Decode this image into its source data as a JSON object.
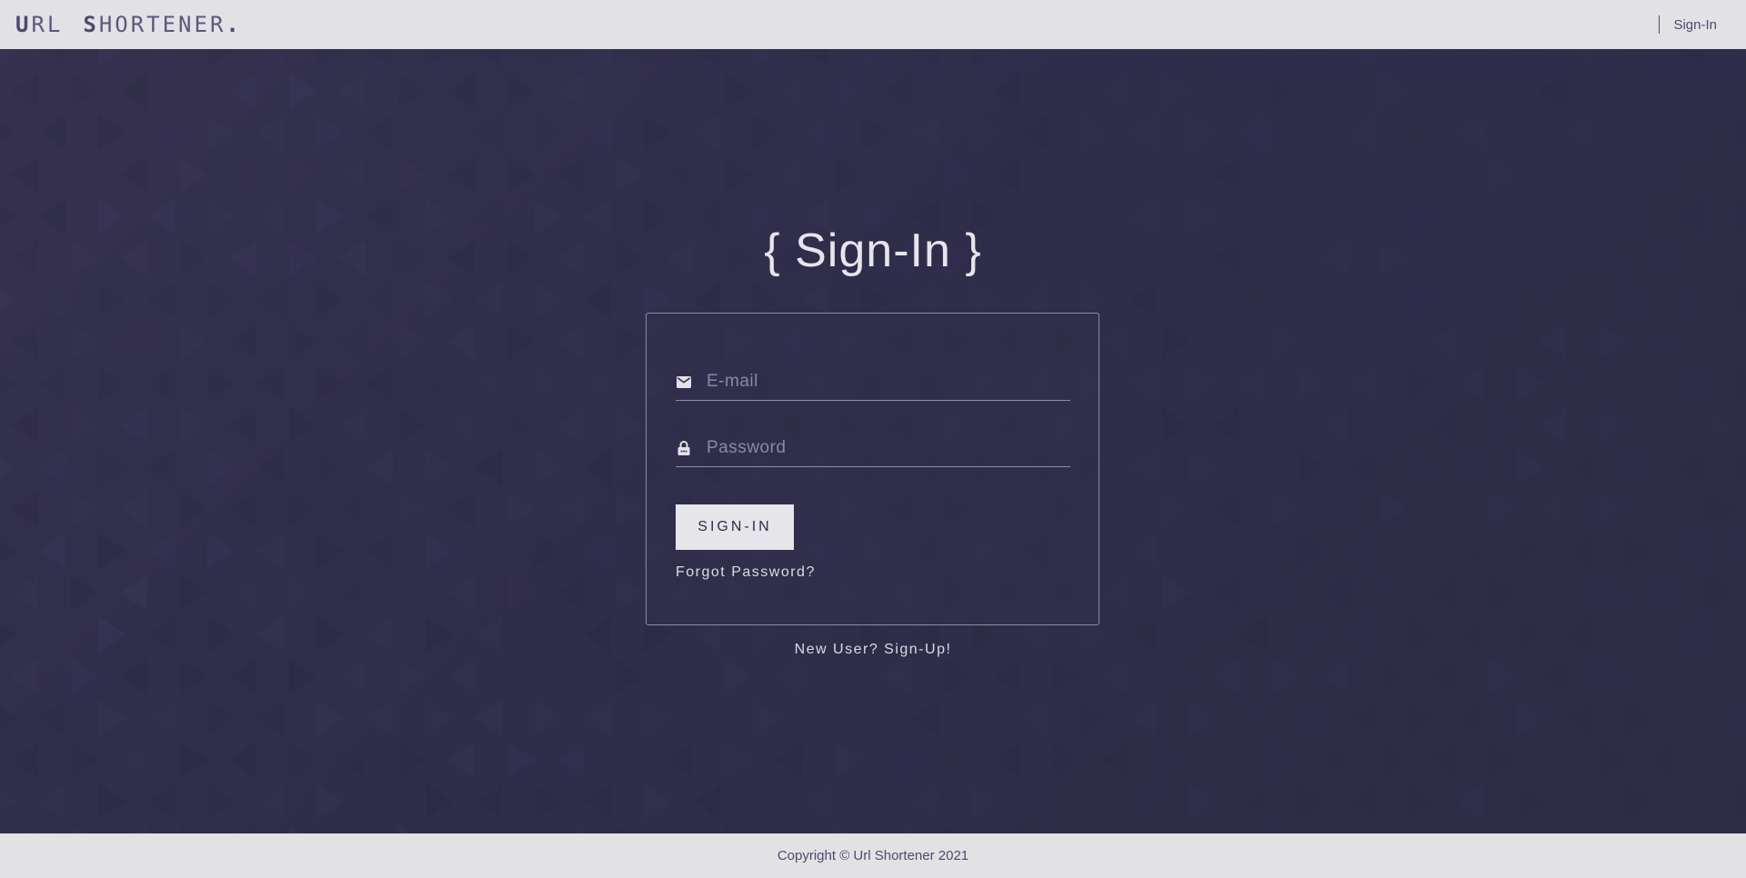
{
  "header": {
    "logo": {
      "part1_lead": "U",
      "part1_rest": "RL",
      "part2_lead": "S",
      "part2_rest": "HORTENER",
      "dot": "."
    },
    "nav": {
      "signin_label": "Sign-In"
    }
  },
  "main": {
    "title": "{ Sign-In }",
    "form": {
      "email": {
        "icon": "envelope-icon",
        "placeholder": "E-mail",
        "value": ""
      },
      "password": {
        "icon": "lock-icon",
        "placeholder": "Password",
        "value": ""
      },
      "submit_label": "SIGN-IN",
      "forgot_label": "Forgot Password?"
    },
    "signup_label": "New User? Sign-Up!"
  },
  "footer": {
    "copyright": "Copyright © Url Shortener 2021"
  },
  "colors": {
    "background": "#2f2e48",
    "header_footer": "#e2e2e4",
    "accent": "#4d4a70",
    "text_light": "#e6e5ec",
    "button_bg": "#e6e5ea"
  }
}
